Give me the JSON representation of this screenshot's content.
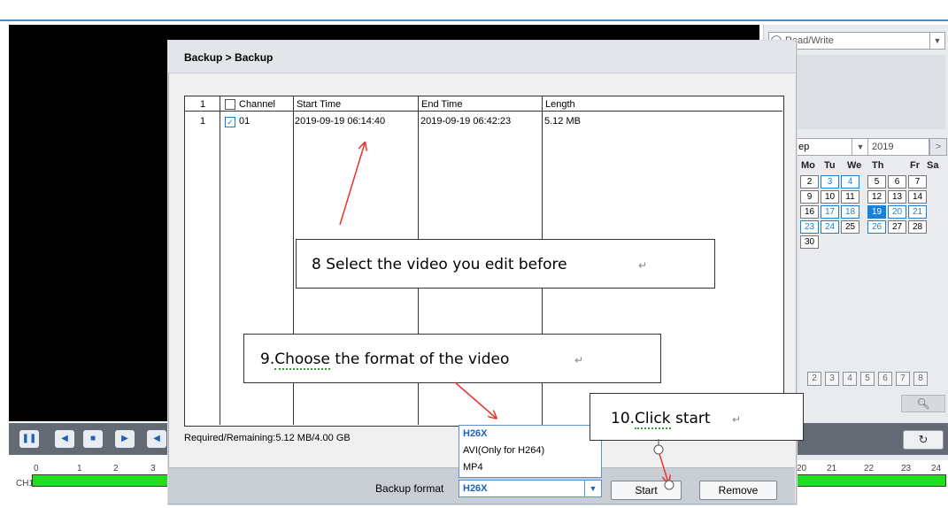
{
  "app": {
    "storage_mode": "Read/Write",
    "calendar": {
      "month": "ep",
      "year": "2019",
      "next_label": ">",
      "weekdays": [
        "Mo",
        "Tu",
        "We",
        "Th",
        "Fr",
        "Sa"
      ],
      "days": [
        "2",
        "3",
        "4",
        "5",
        "6",
        "7",
        "9",
        "10",
        "11",
        "12",
        "13",
        "14",
        "16",
        "17",
        "18",
        "19",
        "20",
        "21",
        "23",
        "24",
        "25",
        "26",
        "27",
        "28",
        "30"
      ],
      "pages": [
        "2",
        "3",
        "4",
        "5",
        "6",
        "7",
        "8"
      ]
    },
    "timeline": {
      "channel": "CH1",
      "left_ticks": [
        "0",
        "1",
        "2",
        "3"
      ],
      "right_ticks": [
        "20",
        "21",
        "22",
        "23",
        "24"
      ]
    }
  },
  "dialog": {
    "title": "Backup > Backup",
    "table": {
      "headers": {
        "index": "1",
        "channel": "Channel",
        "start": "Start Time",
        "end": "End Time",
        "length": "Length"
      },
      "rows": [
        {
          "index": "1",
          "channel": "01",
          "checked": true,
          "start": "2019-09-19 06:14:40",
          "end": "2019-09-19 06:42:23",
          "length": "5.12 MB"
        }
      ]
    },
    "required_remaining": "Required/Remaining:5.12 MB/4.00 GB",
    "backup_format_label": "Backup format",
    "backup_format_value": "H26X",
    "format_options": [
      "H26X",
      "AVI(Only for H264)",
      "MP4"
    ],
    "start_button": "Start",
    "remove_button": "Remove"
  },
  "annotations": {
    "step8": "8 Select the video you edit before",
    "step9_underlined": "Choose",
    "step9_prefix": "9.",
    "step9_suffix": " the format of the video",
    "step10_prefix": "10.",
    "step10_underlined": "Click",
    "step10_suffix": " start",
    "return_mark": "↵",
    "arrow_color": "#e8322e"
  }
}
